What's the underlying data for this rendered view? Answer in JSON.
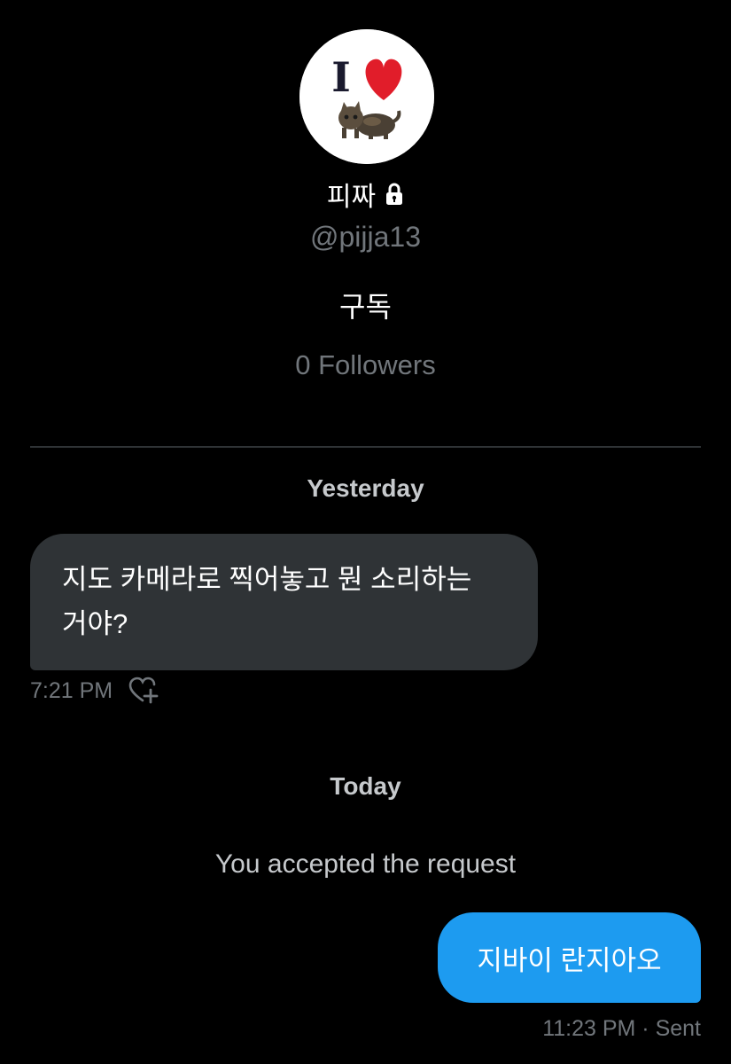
{
  "profile": {
    "display_name": "피짜",
    "handle": "@pijja13",
    "bio": "구독",
    "followers": "0 Followers",
    "avatar_text": "I"
  },
  "conversation": {
    "day1_label": "Yesterday",
    "incoming_message": {
      "text_line1": "지도 카메라로 찍어놓고 뭔 소리하는",
      "text_line2": "거야?",
      "time": "7:21 PM"
    },
    "day2_label": "Today",
    "system_message": "You accepted the request",
    "outgoing_message": {
      "text": "지바이 란지아오",
      "meta": "11:23 PM · Sent"
    }
  },
  "colors": {
    "background": "#000000",
    "incoming_bubble": "#2f3336",
    "outgoing_bubble": "#1d9bf0",
    "secondary_text": "#71767b",
    "divider": "#2f3336"
  },
  "icons": {
    "lock": "lock-icon",
    "heart_add": "heart-plus-icon",
    "avatar_heart": "heart-icon",
    "avatar_cat": "cat-icon"
  }
}
